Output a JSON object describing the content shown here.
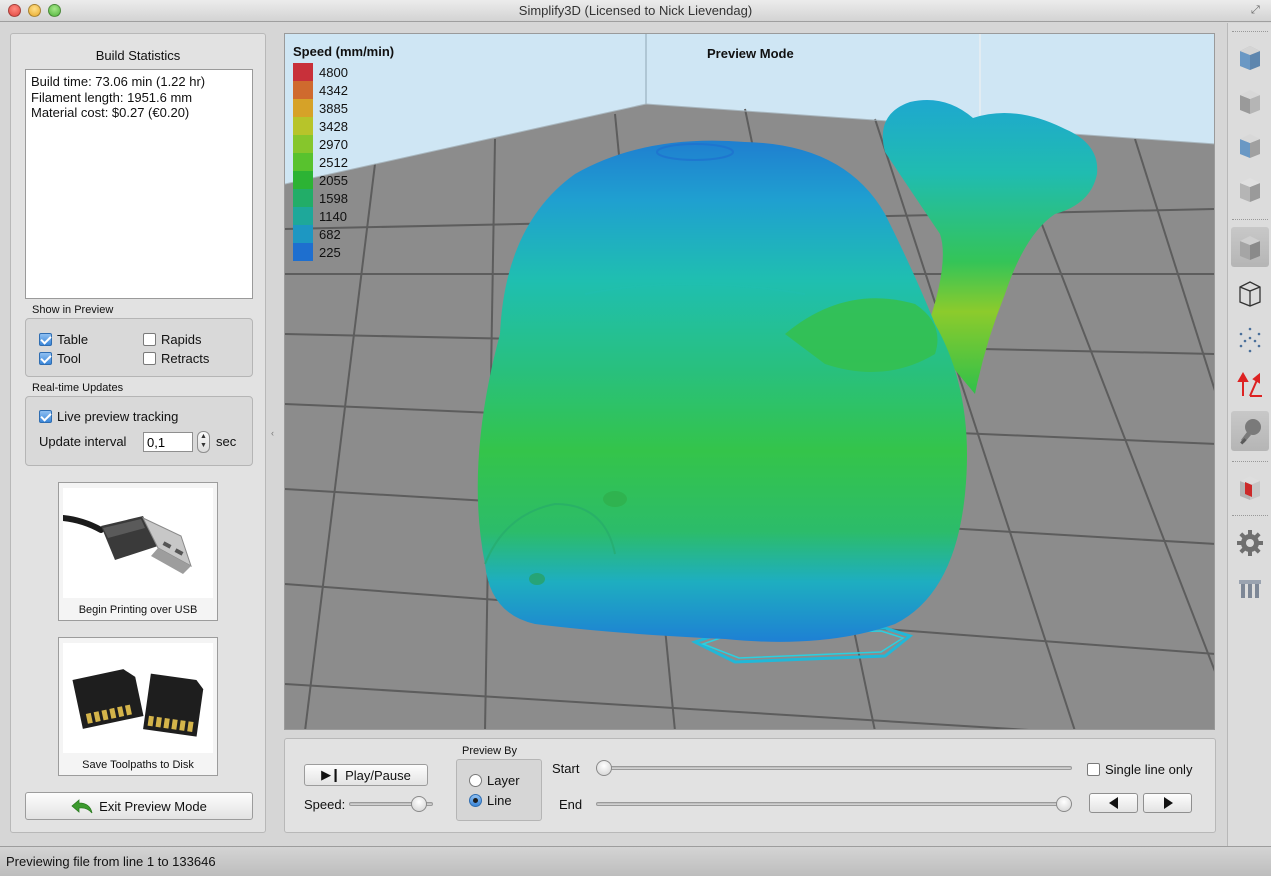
{
  "window": {
    "title": "Simplify3D (Licensed to Nick Lievendag)"
  },
  "left_panel": {
    "build_statistics": {
      "title": "Build Statistics",
      "lines": [
        "Build time: 73.06 min (1.22 hr)",
        "Filament length: 1951.6 mm",
        "Material cost: $0.27 (€0.20)"
      ]
    },
    "show_in_preview": {
      "label": "Show in Preview",
      "table": {
        "label": "Table",
        "checked": true
      },
      "tool": {
        "label": "Tool",
        "checked": true
      },
      "rapids": {
        "label": "Rapids",
        "checked": false
      },
      "retracts": {
        "label": "Retracts",
        "checked": false
      }
    },
    "realtime_updates": {
      "label": "Real-time Updates",
      "live_tracking": {
        "label": "Live preview tracking",
        "checked": true
      },
      "update_interval_label": "Update interval",
      "update_interval_value": "0,1",
      "unit": "sec"
    },
    "usb_button": {
      "caption": "Begin Printing over USB"
    },
    "disk_button": {
      "caption": "Save Toolpaths to Disk"
    },
    "exit_button": {
      "label": "Exit Preview Mode"
    }
  },
  "viewport": {
    "mode_label": "Preview Mode",
    "legend": {
      "title": "Speed (mm/min)",
      "entries": [
        {
          "value": "4800",
          "color": "#c8303a"
        },
        {
          "value": "4342",
          "color": "#cf6a2e"
        },
        {
          "value": "3885",
          "color": "#d6a228"
        },
        {
          "value": "3428",
          "color": "#b7c42a"
        },
        {
          "value": "2970",
          "color": "#86c62c"
        },
        {
          "value": "2512",
          "color": "#58c22e"
        },
        {
          "value": "2055",
          "color": "#2cb334"
        },
        {
          "value": "1598",
          "color": "#22ad68"
        },
        {
          "value": "1140",
          "color": "#1ea89a"
        },
        {
          "value": "682",
          "color": "#1d97c2"
        },
        {
          "value": "225",
          "color": "#1e6fcf"
        }
      ]
    }
  },
  "controls": {
    "play_pause_label": "Play/Pause",
    "speed_label": "Speed:",
    "speed_fraction": 0.83,
    "preview_by": {
      "label": "Preview By",
      "layer": {
        "label": "Layer",
        "selected": false
      },
      "line": {
        "label": "Line",
        "selected": true
      }
    },
    "start_label": "Start",
    "start_fraction": 0.0,
    "end_label": "End",
    "end_fraction": 1.0,
    "single_line_only": {
      "label": "Single line only",
      "checked": false
    }
  },
  "toolbar_icons": [
    "cube-front-view-icon",
    "cube-top-view-icon",
    "cube-side-view-icon",
    "cube-iso-view-icon",
    "solid-view-icon",
    "wireframe-view-icon",
    "point-cloud-view-icon",
    "axes-icon",
    "lighting-icon",
    "cross-section-icon",
    "gear-icon",
    "build-supports-icon"
  ],
  "status_bar": {
    "text": "Previewing file from line 1 to 133646"
  }
}
